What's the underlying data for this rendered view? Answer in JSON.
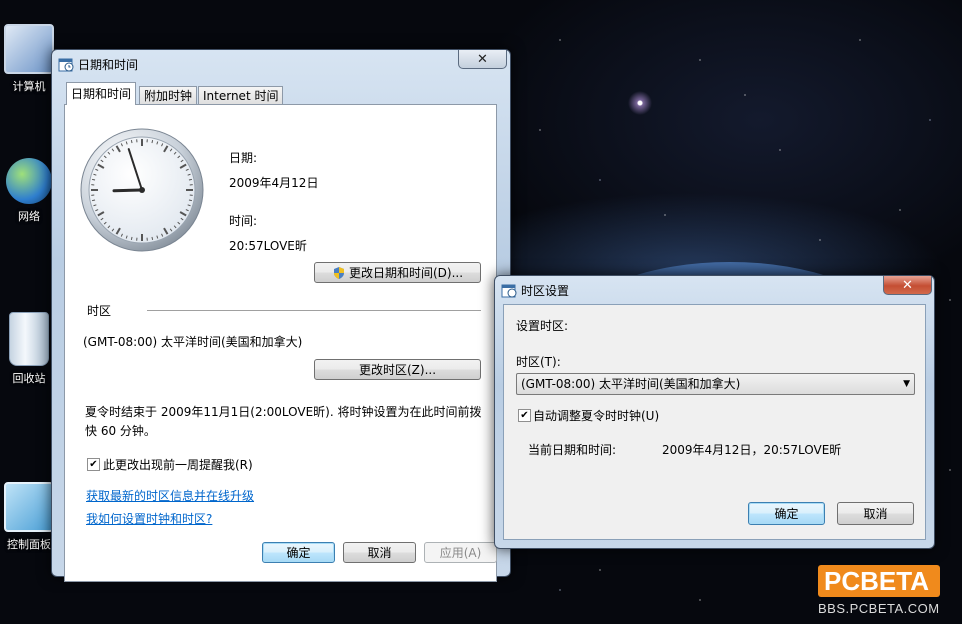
{
  "desktop": {
    "icons": [
      {
        "label": "计算机"
      },
      {
        "label": "网络"
      },
      {
        "label": "回收站"
      },
      {
        "label": "控制面板"
      }
    ]
  },
  "datetime_dialog": {
    "title": "日期和时间",
    "tabs": [
      {
        "label": "日期和时间",
        "active": true
      },
      {
        "label": "附加时钟",
        "active": false
      },
      {
        "label": "Internet 时间",
        "active": false
      }
    ],
    "date_label": "日期:",
    "date_value": "2009年4月12日",
    "time_label": "时间:",
    "time_value": "20:57LOVE昕",
    "change_datetime_button": "更改日期和时间(D)...",
    "timezone_section": "时区",
    "timezone_value": "(GMT-08:00) 太平洋时间(美国和加拿大)",
    "change_timezone_button": "更改时区(Z)...",
    "dst_notice_line1": "夏令时结束于 2009年11月1日(2:00LOVE昕). 将时钟设置为在此时间前拨",
    "dst_notice_line2": "快 60 分钟。",
    "remind_checkbox_label": "此更改出现前一周提醒我(R)",
    "remind_checked": true,
    "link_update": "获取最新的时区信息并在线升级",
    "link_help": "我如何设置时钟和时区?",
    "ok_button": "确定",
    "cancel_button": "取消",
    "apply_button": "应用(A)",
    "clock": {
      "hour": 20,
      "minute": 57
    }
  },
  "timezone_dialog": {
    "title": "时区设置",
    "set_label": "设置时区:",
    "tz_field_label": "时区(T):",
    "tz_selected": "(GMT-08:00) 太平洋时间(美国和加拿大)",
    "auto_dst_label": "自动调整夏令时时钟(U)",
    "auto_dst_checked": true,
    "current_label": "当前日期和时间:",
    "current_value": "2009年4月12日，20:57LOVE昕",
    "ok_button": "确定",
    "cancel_button": "取消"
  },
  "watermark": {
    "brand": "PCBETA",
    "url": "BBS.PCBETA.COM"
  },
  "colors": {
    "accent": "#3c7fb1",
    "link": "#0066cc",
    "close_red": "#c44e33",
    "watermark_orange": "#f08a1c"
  }
}
